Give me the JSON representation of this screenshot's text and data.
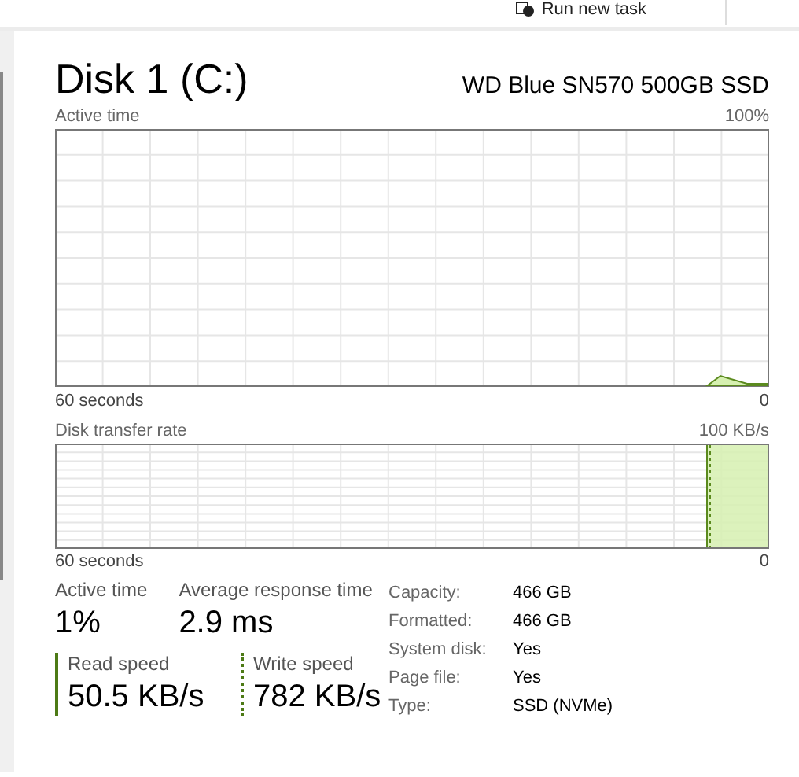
{
  "toolbar": {
    "run_new_task": "Run new task"
  },
  "disk": {
    "title": "Disk 1 (C:)",
    "model": "WD Blue SN570 500GB SSD"
  },
  "active_time_graph": {
    "label": "Active time",
    "max": "100%",
    "span": "60 seconds",
    "min": "0"
  },
  "transfer_rate_graph": {
    "label": "Disk transfer rate",
    "max": "100 KB/s",
    "span": "60 seconds",
    "min": "0"
  },
  "stats": [
    {
      "label": "Active time",
      "value": "1%"
    },
    {
      "label": "Average response time",
      "value": "2.9 ms"
    }
  ],
  "speeds": [
    {
      "kind": "read",
      "label": "Read speed",
      "value": "50.5 KB/s"
    },
    {
      "kind": "write",
      "label": "Write speed",
      "value": "782 KB/s"
    }
  ],
  "properties": [
    {
      "label": "Capacity:",
      "value": "466 GB"
    },
    {
      "label": "Formatted:",
      "value": "466 GB"
    },
    {
      "label": "System disk:",
      "value": "Yes"
    },
    {
      "label": "Page file:",
      "value": "Yes"
    },
    {
      "label": "Type:",
      "value": "SSD (NVMe)"
    }
  ]
}
